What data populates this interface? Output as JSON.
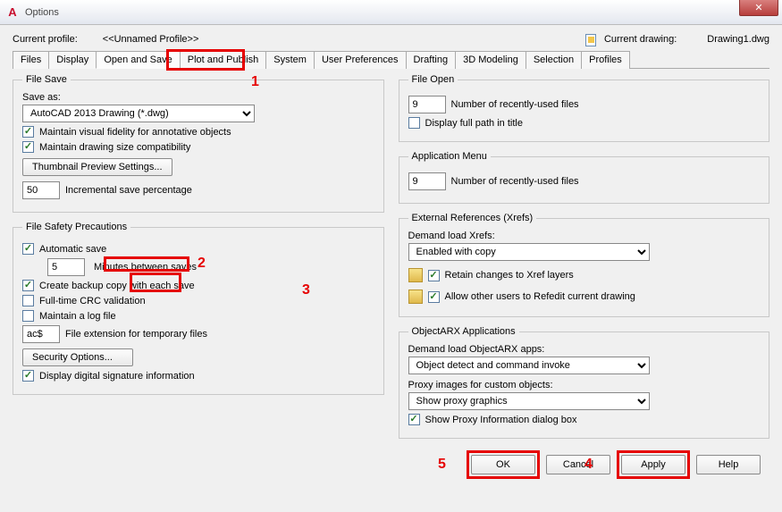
{
  "window": {
    "title": "Options"
  },
  "profile": {
    "label": "Current profile:",
    "value": "<<Unnamed Profile>>",
    "drawing_label": "Current drawing:",
    "drawing_value": "Drawing1.dwg"
  },
  "tabs": [
    "Files",
    "Display",
    "Open and Save",
    "Plot and Publish",
    "System",
    "User Preferences",
    "Drafting",
    "3D Modeling",
    "Selection",
    "Profiles"
  ],
  "active_tab": 2,
  "file_save": {
    "legend": "File Save",
    "save_as_label": "Save as:",
    "save_as_value": "AutoCAD 2013 Drawing (*.dwg)",
    "maintain_visual": "Maintain visual fidelity for annotative objects",
    "maintain_size": "Maintain drawing size compatibility",
    "thumb_btn": "Thumbnail Preview Settings...",
    "incr_value": "50",
    "incr_label": "Incremental save percentage"
  },
  "file_safety": {
    "legend": "File Safety Precautions",
    "auto_save": "Automatic save",
    "mins_value": "5",
    "mins_label": "Minutes between saves",
    "backup": "Create backup copy with each save",
    "crc": "Full-time CRC validation",
    "log": "Maintain a log file",
    "ext_value": "ac$",
    "ext_label": "File extension for temporary files",
    "sec_btn": "Security Options...",
    "sig": "Display digital signature information"
  },
  "file_open": {
    "legend": "File Open",
    "num_value": "9",
    "num_label": "Number of recently-used files",
    "full_path": "Display full path in title"
  },
  "app_menu": {
    "legend": "Application Menu",
    "num_value": "9",
    "num_label": "Number of recently-used files"
  },
  "xrefs": {
    "legend": "External References (Xrefs)",
    "demand_label": "Demand load Xrefs:",
    "demand_value": "Enabled with copy",
    "retain": "Retain changes to Xref layers",
    "allow": "Allow other users to Refedit current drawing"
  },
  "arx": {
    "legend": "ObjectARX Applications",
    "demand_label": "Demand load ObjectARX apps:",
    "demand_value": "Object detect and command invoke",
    "proxy_label": "Proxy images for custom objects:",
    "proxy_value": "Show proxy graphics",
    "show_dlg": "Show Proxy Information dialog box"
  },
  "footer": {
    "ok": "OK",
    "cancel": "Cancel",
    "apply": "Apply",
    "help": "Help"
  },
  "annotations": {
    "n1": "1",
    "n2": "2",
    "n3": "3",
    "n4": "4",
    "n5": "5"
  }
}
